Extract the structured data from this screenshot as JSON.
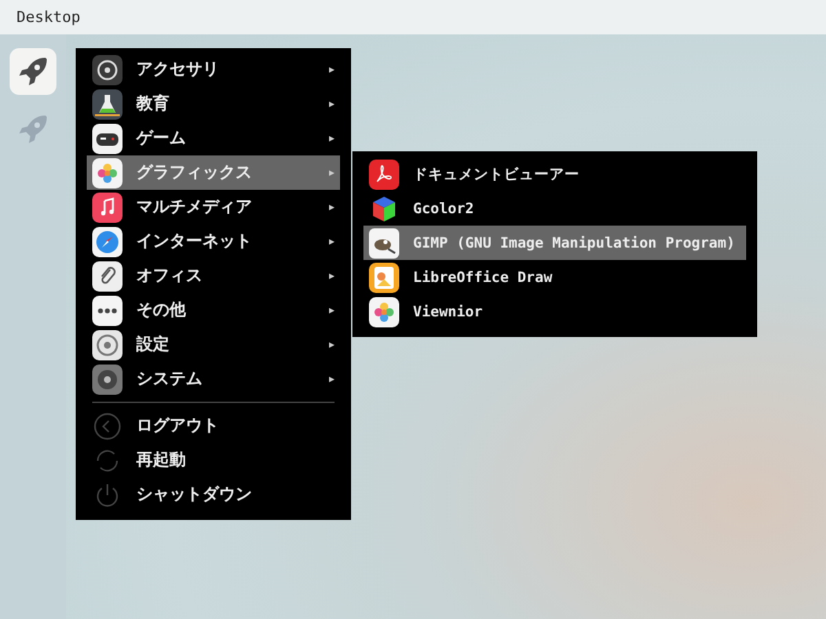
{
  "top_bar": {
    "title": "Desktop"
  },
  "dock": {
    "items": [
      {
        "selected": true
      },
      {
        "selected": false
      }
    ]
  },
  "main_menu": {
    "items": [
      {
        "label": "アクセサリ",
        "arrow": "▸",
        "selected": false
      },
      {
        "label": "教育",
        "arrow": "▸",
        "selected": false
      },
      {
        "label": "ゲーム",
        "arrow": "▸",
        "selected": false
      },
      {
        "label": "グラフィックス",
        "arrow": "▸",
        "selected": true
      },
      {
        "label": "マルチメディア",
        "arrow": "▸",
        "selected": false
      },
      {
        "label": "インターネット",
        "arrow": "▸",
        "selected": false
      },
      {
        "label": "オフィス",
        "arrow": "▸",
        "selected": false
      },
      {
        "label": "その他",
        "arrow": "▸",
        "selected": false
      },
      {
        "label": "設定",
        "arrow": "▸",
        "selected": false
      },
      {
        "label": "システム",
        "arrow": "▸",
        "selected": false
      }
    ],
    "session_items": [
      {
        "label": "ログアウト",
        "selected": false
      },
      {
        "label": "再起動",
        "selected": false
      },
      {
        "label": "シャットダウン",
        "selected": false
      }
    ]
  },
  "submenu": {
    "items": [
      {
        "label": "ドキュメントビューアー",
        "selected": false
      },
      {
        "label": "Gcolor2",
        "selected": false
      },
      {
        "label": "GIMP (GNU Image Manipulation Program)",
        "selected": true
      },
      {
        "label": "LibreOffice Draw",
        "selected": false
      },
      {
        "label": "Viewnior",
        "selected": false
      }
    ]
  }
}
